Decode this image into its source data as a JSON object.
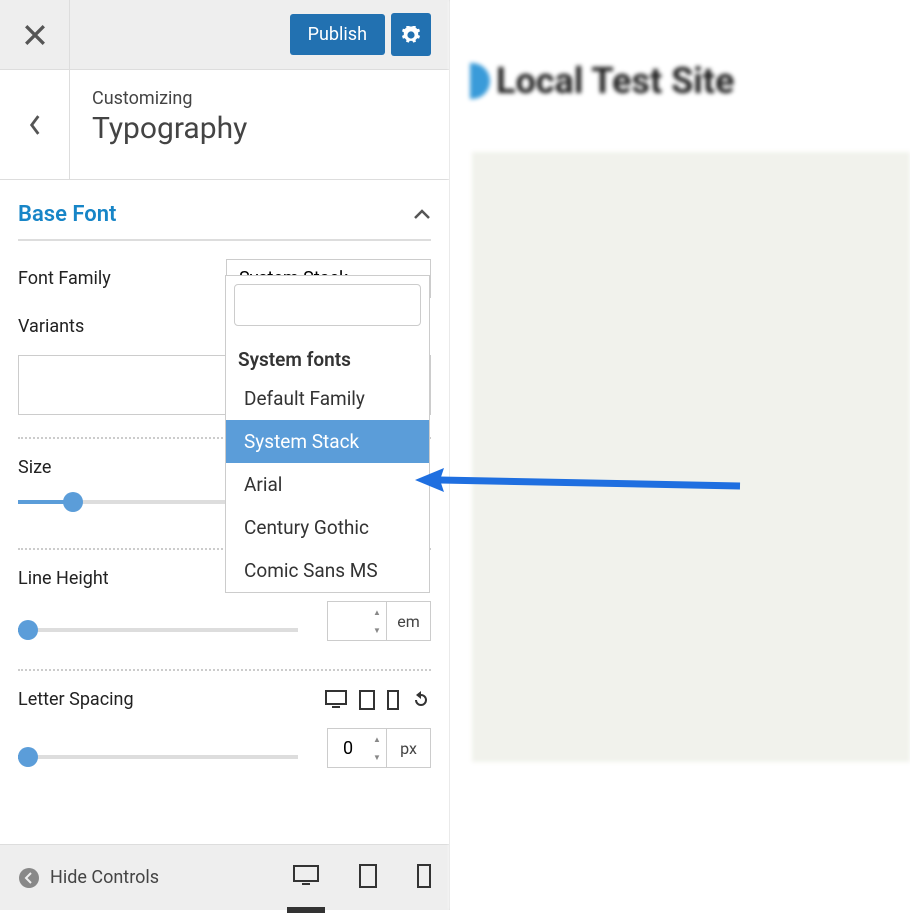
{
  "header": {
    "publish_label": "Publish"
  },
  "subheader": {
    "customizing": "Customizing",
    "section": "Typography"
  },
  "base_font": {
    "title": "Base Font",
    "font_family_label": "Font Family",
    "font_family_value": "System Stack",
    "variants_label": "Variants"
  },
  "dropdown": {
    "group": "System fonts",
    "items": [
      "Default Family",
      "System Stack",
      "Arial",
      "Century Gothic",
      "Comic Sans MS"
    ],
    "selected_index": 1
  },
  "size": {
    "label": "Size"
  },
  "line_height": {
    "label": "Line Height",
    "unit": "em"
  },
  "letter_spacing": {
    "label": "Letter Spacing",
    "value": "0",
    "unit": "px"
  },
  "footer": {
    "hide_controls": "Hide Controls"
  },
  "preview": {
    "site_title": "Local Test Site"
  }
}
